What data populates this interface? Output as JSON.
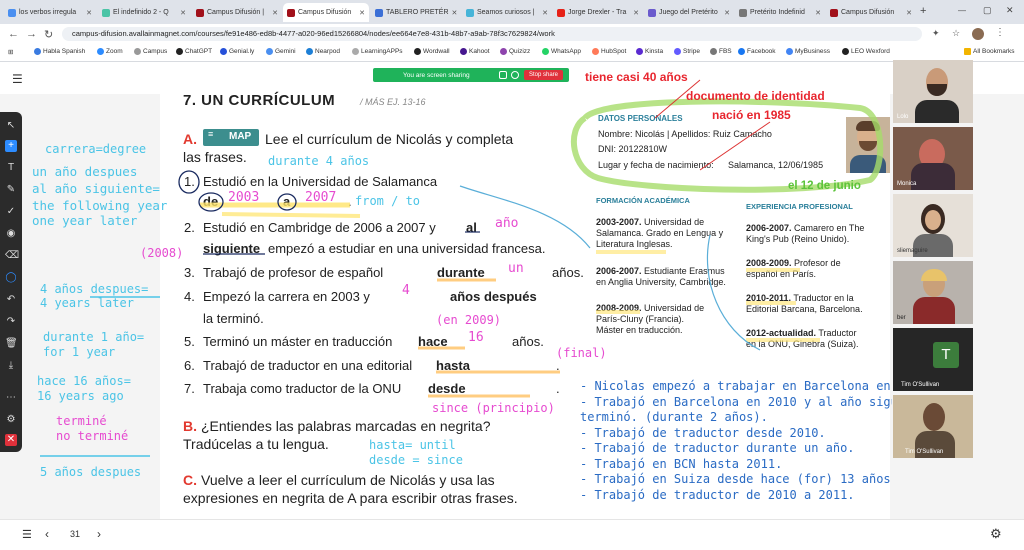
{
  "browser": {
    "tabs": [
      {
        "label": "los verbos irregula",
        "color": "#4a8ff0"
      },
      {
        "label": "El indefinido 2 - Q",
        "color": "#4ac4a6"
      },
      {
        "label": "Campus Difusión |",
        "color": "#a1101a"
      },
      {
        "label": "Campus Difusión",
        "color": "#a1101a"
      },
      {
        "label": "TABLERO PRETÉR",
        "color": "#3b6fd6"
      },
      {
        "label": "Seamos curiosos |",
        "color": "#46b4d8"
      },
      {
        "label": "Jorge Drexler - Tra",
        "color": "#e62117"
      },
      {
        "label": "Juego del Pretérito",
        "color": "#6a5acd"
      },
      {
        "label": "Pretérito Indefinid",
        "color": "#777777"
      },
      {
        "label": "Campus Difusión",
        "color": "#a1101a"
      }
    ],
    "url": "campus-difusion.avallainmagnet.com/courses/fe91e486-ed8b-4477-a020-96ed15266804/nodes/ee664e7e8-431b-48b7-a9ab-78f3c7629824/work",
    "bookmarks": [
      "Habla Spanish",
      "Zoom",
      "Campus",
      "ChatGPT",
      "Genial.ly",
      "Gemini",
      "Nearpod",
      "LearningAPPs",
      "Wordwall",
      "Kahoot",
      "Quizizz",
      "WhatsApp",
      "HubSpot",
      "Kinsta",
      "Stripe",
      "FBS",
      "Facebook",
      "MyBusiness",
      "LEO Wexford"
    ],
    "all_bookmarks": "All Bookmarks"
  },
  "share": {
    "text": "You are screen sharing",
    "stop": "Stop share"
  },
  "worksheet": {
    "heading": "7. UN CURRÍCULUM",
    "heading_ref": "/ MÁS EJ. 13-16",
    "a_letter": "A.",
    "map_label": "MAP",
    "a_text_1": "Lee el currículum de Nicolás y completa",
    "a_text_2": "las frases.",
    "items": [
      {
        "n": "1.",
        "text": "Estudió en la Universidad de Salamanca",
        "l2a": "de",
        "l2b": "a",
        "l2c": ".",
        "p2003": "2003",
        "p2007": "2007"
      },
      {
        "n": "2.",
        "text": "Estudió en Cambridge de 2006 a 2007 y",
        "bold": "al",
        "fill": "año",
        "l2bold": "siguiente",
        "l2rest": "empezó a estudiar en una universidad francesa."
      },
      {
        "n": "3.",
        "text": "Trabajó de profesor de español",
        "bold": "durante",
        "fill": "un",
        "rest": "años."
      },
      {
        "n": "4.",
        "text": "Empezó la carrera en 2003 y",
        "fill": "4",
        "bold": "años después",
        "l2": "la terminó."
      },
      {
        "n": "5.",
        "text": "Terminó un máster en traducción",
        "bold": "hace",
        "fill": "16",
        "rest": "años."
      },
      {
        "n": "6.",
        "text": "Trabajó de traductor en una editorial",
        "bold": "hasta",
        "rest": "."
      },
      {
        "n": "7.",
        "text": "Trabaja como traductor de la ONU",
        "bold": "desde",
        "rest": "."
      }
    ],
    "b_letter": "B.",
    "b_text_1": "¿Entiendes las palabras marcadas en negrita?",
    "b_text_2": "Tradúcelas a tu lengua.",
    "c_letter": "C.",
    "c_text_1": "Vuelve a leer el currículum de Nicolás y usa las",
    "c_text_2": "expresiones en negrita de A para escribir otras frases."
  },
  "cv": {
    "datos_title": "DATOS PERSONALES",
    "nombre": "Nombre: Nicolás | Apellidos: Ruiz Camacho",
    "dni": "DNI: 20122810W",
    "lugar": "Lugar y fecha de nacimiento:",
    "lugar_val": "Salamanca, 12/06/1985",
    "formacion_title": "FORMACIÓN ACADÉMICA",
    "formacion": [
      {
        "years": "2003-2007.",
        "rest": " Universidad de",
        "l2": "Salamanca. Grado en Lengua y",
        "l3": "Literatura Inglesas."
      },
      {
        "years": "2006-2007.",
        "rest": " Estudiante Erasmus",
        "l2": "en Anglia University, Cambridge.",
        "l3": ""
      },
      {
        "years": "2008-2009.",
        "rest": " Universidad de",
        "l2": "París-Cluny (Francia).",
        "l3": "Máster en traducción."
      }
    ],
    "experiencia_title": "EXPERIENCIA PROFESIONAL",
    "experiencia": [
      {
        "years": "2006-2007.",
        "rest": " Camarero en The",
        "l2": "King's Pub (Reino Unido).",
        "l3": ""
      },
      {
        "years": "2008-2009.",
        "rest": " Profesor de",
        "l2": "español en París.",
        "l3": ""
      },
      {
        "years": "2010-2011.",
        "rest": " Traductor en la",
        "l2": "Editorial Barcana, Barcelona.",
        "l3": ""
      },
      {
        "years": "2012-actualidad.",
        "rest": " Traductor",
        "l2": "en la ONU, Ginebra (Suiza).",
        "l3": ""
      }
    ]
  },
  "annotations": {
    "cyan": {
      "carrera": "carrera=degree",
      "un_anio": "un año despues",
      "al_anio": "al año siguiente=",
      "following": "the following year",
      "one_year": "one year later",
      "cuatro_anios": "4 años despues=",
      "four_years": "4 years later",
      "durante": "durante 1 año=",
      "for_one": "for 1 year",
      "hace": "hace 16 años=",
      "sixteen": "16 years ago",
      "cinco": "5 años despues",
      "durante4": "durante 4 años",
      "from_to": "from / to",
      "hasta_until": "hasta= until",
      "desde_since": "desde = since"
    },
    "magenta": {
      "y2008": "(2008)",
      "termine": "terminé",
      "no_termine": "no terminé",
      "en2009": "(en 2009)",
      "final": "(final)",
      "since_principio": "since (principio)"
    },
    "red": {
      "cuarenta": "tiene casi 40 años",
      "doc": "documento de identidad",
      "nacio": "nació en 1985",
      "junio": "el 12 de junio"
    },
    "blue_list": [
      "- Nicolas empezó a trabajar en Barcelona en 2010",
      "- Trabajó en Barcelona en 2010 y al año siguiente",
      "terminó. (durante 2 años).",
      "- Trabajó de traductor desde 2010.",
      "- Trabajó de traductor durante un año.",
      "- Trabajó en BCN hasta 2011.",
      "- Trabajó en Suiza desde hace (for) 13 años.",
      "- Trabajó de traductor de 2010 a 2011."
    ]
  },
  "participants": [
    {
      "name": "Lolo"
    },
    {
      "name": "Monica"
    },
    {
      "name": "sliemaguire"
    },
    {
      "name": "ber"
    },
    {
      "name": "Tim O'Sullivan",
      "initial": "T"
    },
    {
      "name": "Tim O'Sullivan"
    }
  ],
  "pager": {
    "page": "31"
  }
}
